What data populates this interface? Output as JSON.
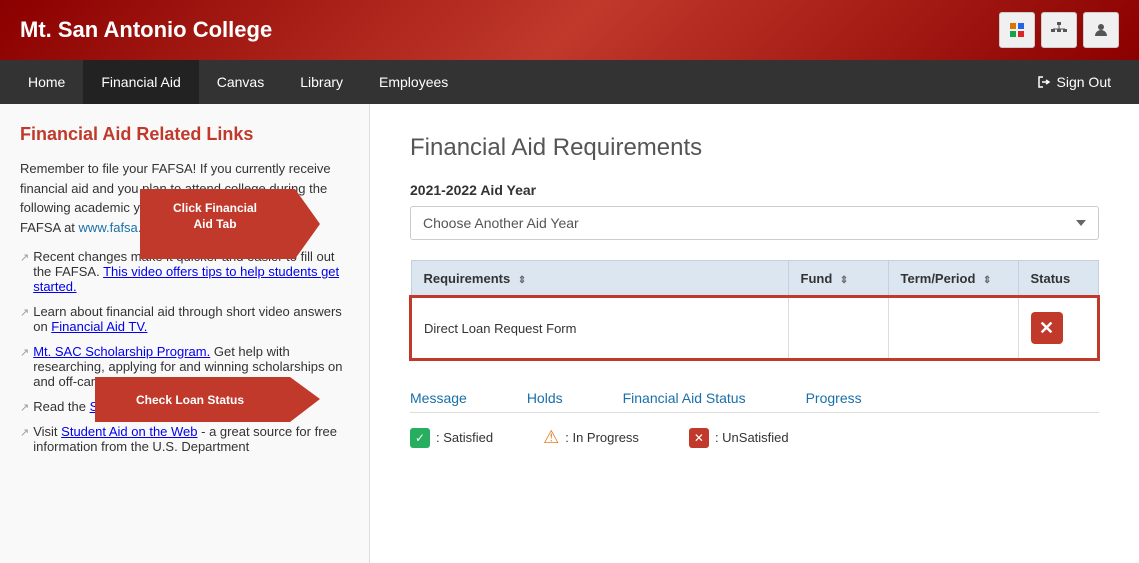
{
  "header": {
    "title": "Mt. San Antonio College",
    "icons": [
      "office-icon",
      "org-icon",
      "user-icon"
    ]
  },
  "nav": {
    "items": [
      {
        "label": "Home",
        "active": false
      },
      {
        "label": "Financial Aid",
        "active": true
      },
      {
        "label": "Canvas",
        "active": false
      },
      {
        "label": "Library",
        "active": false
      },
      {
        "label": "Employees",
        "active": false
      }
    ],
    "signout_label": "Sign Out"
  },
  "sidebar": {
    "title": "Financial Aid Related Links",
    "intro_text": "Remember to file your FAFSA!  If you currently receive financial aid and you plan to attend college during the following academic year, remember to renew your FAFSA at",
    "fafsa_url": "www.fafsa.gov",
    "links": [
      {
        "prefix": "Recent changes make it quicker and easier to fill out the FAFSA.",
        "link_text": "This video offers tips to help students get started.",
        "link_url": "#"
      },
      {
        "prefix": "Learn about financial aid through short video answers on",
        "link_text": "Financial Aid TV.",
        "link_url": "#"
      },
      {
        "prefix": "",
        "link_text": "Mt. SAC Scholarship Program.",
        "link_url": "#",
        "suffix": "Get help with researching, applying for and winning scholarships on and off-campus."
      },
      {
        "prefix": "Read the",
        "link_text": "Smart Guide to Financial Aid.",
        "link_url": "#"
      },
      {
        "prefix": "Visit",
        "link_text": "Student Aid on the Web",
        "link_url": "#",
        "suffix": "- a great source for free information from the U.S. Department"
      }
    ],
    "annotation1": "Click Financial Aid Tab",
    "annotation2": "Check Loan Status"
  },
  "content": {
    "title": "Financial Aid Requirements",
    "aid_year_label": "2021-2022 Aid Year",
    "aid_year_select": "Choose Another Aid Year",
    "table": {
      "columns": [
        {
          "label": "Requirements",
          "sortable": true
        },
        {
          "label": "Fund",
          "sortable": true
        },
        {
          "label": "Term/Period",
          "sortable": true
        },
        {
          "label": "Status",
          "sortable": false
        }
      ],
      "rows": [
        {
          "requirement": "Direct Loan Request Form",
          "fund": "",
          "term_period": "",
          "status": "unsatisfied"
        }
      ]
    },
    "legend": {
      "headers": [
        "Message",
        "Holds",
        "Financial Aid Status",
        "Progress"
      ],
      "items": [
        {
          "icon": "satisfied",
          "label": ": Satisfied"
        },
        {
          "icon": "inprogress",
          "label": ": In Progress"
        },
        {
          "icon": "unsatisfied",
          "label": ": UnSatisfied"
        }
      ]
    }
  }
}
